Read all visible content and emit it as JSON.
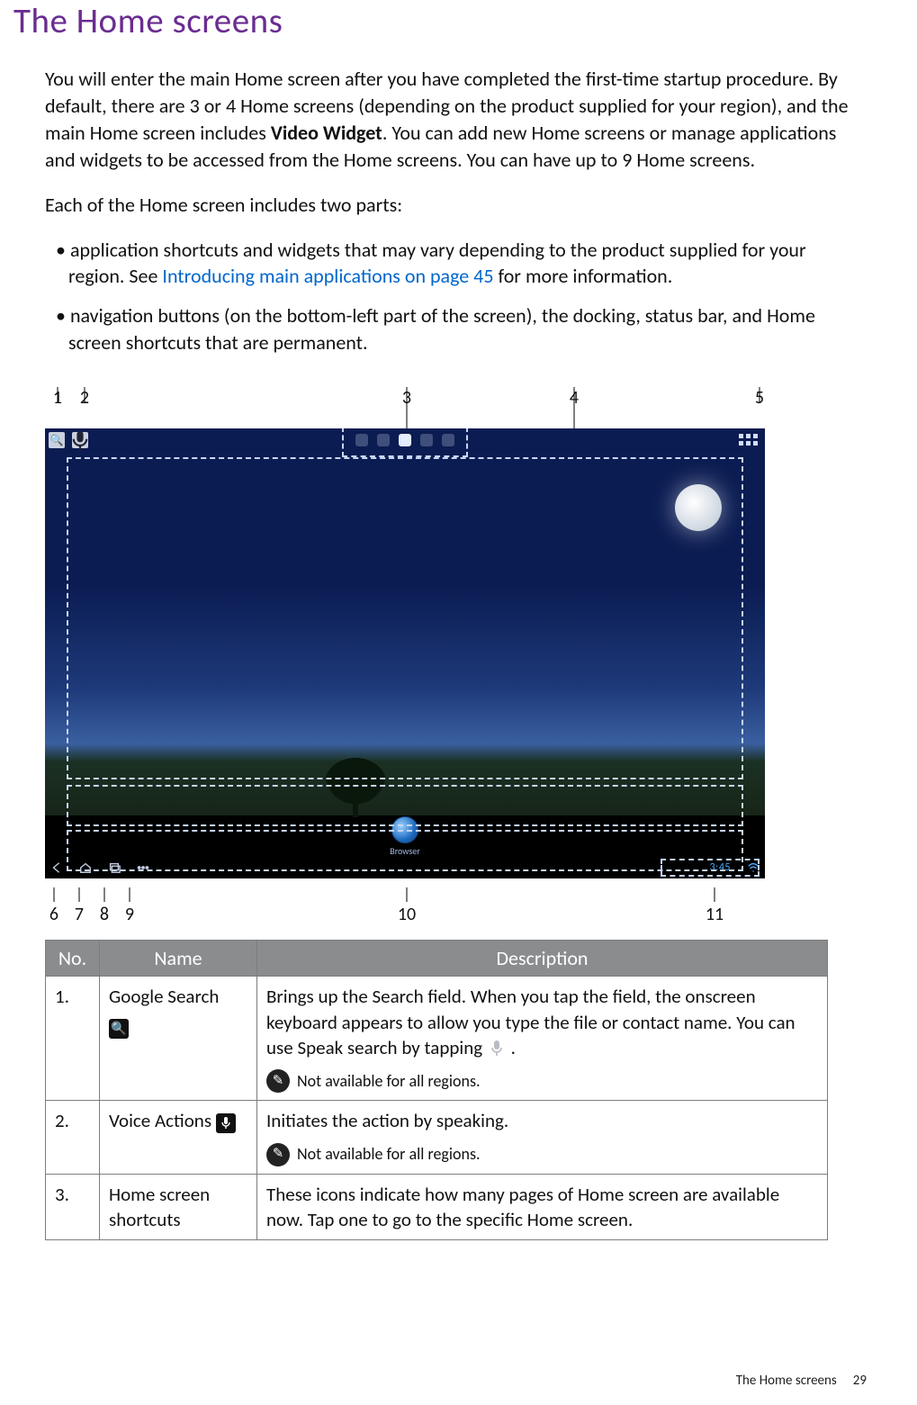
{
  "title": "The Home screens",
  "intro": {
    "p1a": "You will enter the main Home screen after you have completed the first-time startup procedure. By default, there are 3 or 4 Home screens (depending on the product supplied for your region), and the main Home screen includes ",
    "p1bold": "Video Widget",
    "p1b": ". You can add new Home screens or manage applications and widgets to be accessed from the Home screens. You can have up to 9 Home screens.",
    "p2": "Each of the Home screen includes two parts:",
    "bullet1a": "application shortcuts and widgets that may vary depending to the product supplied for your region. See ",
    "bullet1link": "Introducing main applications on page 45",
    "bullet1b": " for more information.",
    "bullet2": "navigation buttons (on the bottom-left part of the screen), the docking, status bar, and Home screen shortcuts that are permanent."
  },
  "callouts": {
    "top": [
      "1",
      "2",
      "3",
      "4",
      "5"
    ],
    "bottom": [
      "6",
      "7",
      "8",
      "9",
      "10",
      "11"
    ]
  },
  "screenshot": {
    "dock_label": "Browser",
    "time": "3:45"
  },
  "table": {
    "headers": {
      "no": "No.",
      "name": "Name",
      "desc": "Description"
    },
    "rows": [
      {
        "no": "1.",
        "name": "Google Search",
        "desc_a": "Brings up the Search field. When you tap the field, the onscreen keyboard appears to allow you type the file or contact name. You can use Speak search by tapping ",
        "desc_b": ".",
        "note": "Not available for all regions."
      },
      {
        "no": "2.",
        "name": "Voice Actions",
        "desc_a": "Initiates the action by speaking.",
        "note": "Not available for all regions."
      },
      {
        "no": "3.",
        "name": "Home screen shortcuts",
        "desc_a": "These icons indicate how many pages of Home screen are available now. Tap one to go to the specific Home screen."
      }
    ]
  },
  "footer": {
    "label": "The Home screens",
    "page": "29"
  }
}
